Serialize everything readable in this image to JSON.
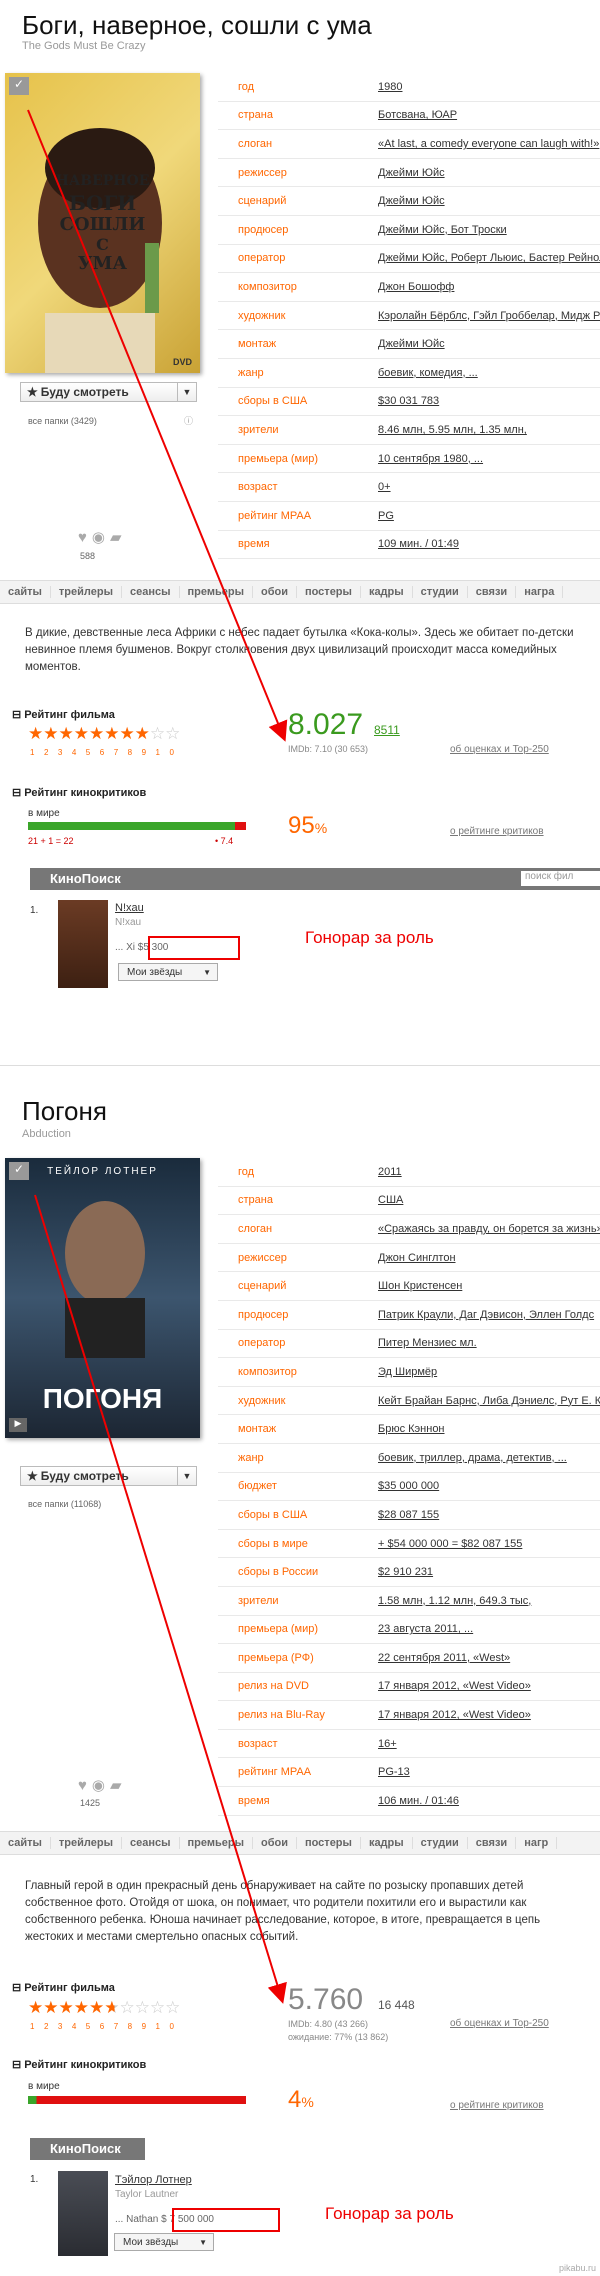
{
  "film1": {
    "title": "Боги, наверное, сошли с ума",
    "original_title": "The Gods Must Be Crazy",
    "poster_text": [
      "НАВЕРНОЕ",
      "БОГИ",
      "СОШЛИ",
      "С",
      "УМА"
    ],
    "poster_sub": "DVD",
    "info": [
      {
        "k": "год",
        "v": "1980"
      },
      {
        "k": "страна",
        "v": "Ботсвана, ЮАР"
      },
      {
        "k": "слоган",
        "v": "«At last, a comedy everyone can laugh with!»"
      },
      {
        "k": "режиссер",
        "v": "Джейми Юйс"
      },
      {
        "k": "сценарий",
        "v": "Джейми Юйс"
      },
      {
        "k": "продюсер",
        "v": "Джейми Юйс, Бот Троски"
      },
      {
        "k": "оператор",
        "v": "Джейми Юйс, Роберт Льюис, Бастер Рейнолд"
      },
      {
        "k": "композитор",
        "v": "Джон Бошофф"
      },
      {
        "k": "художник",
        "v": "Кэролайн Бёрблс, Гэйл Гроббелар, Мидж Ре"
      },
      {
        "k": "монтаж",
        "v": "Джейми Юйс"
      },
      {
        "k": "жанр",
        "v": "боевик, комедия, ..."
      },
      {
        "k": "сборы в США",
        "v": "$30 031 783"
      },
      {
        "k": "зрители",
        "v": "8.46 млн,   5.95 млн,   1.35 млн,"
      },
      {
        "k": "премьера (мир)",
        "v": "10 сентября 1980, ..."
      },
      {
        "k": "возраст",
        "v": "0+"
      },
      {
        "k": "рейтинг MPAA",
        "v": "PG"
      },
      {
        "k": "время",
        "v": "109 мин. / 01:49"
      }
    ],
    "watch_label": "Буду смотреть",
    "folders": "все папки (3429)",
    "like_count": "588",
    "tabs": [
      "сайты",
      "трейлеры",
      "сеансы",
      "премьеры",
      "обои",
      "постеры",
      "кадры",
      "студии",
      "связи",
      "награ"
    ],
    "description": "В дикие, девственные леса Африки с небес падает бутылка «Кока-колы». Здесь же обитает по-детски невинное племя бушменов. Вокруг столкновения двух цивилизаций происходит масса комедийных моментов.",
    "rating_label": "Рейтинг фильма",
    "rating": "8.027",
    "rating_votes": "8511",
    "imdb": "IMDb: 7.10 (30 653)",
    "rating_link": "об оценках и Top-250",
    "star_nums": "12345678910",
    "critics_label": "Рейтинг кинокритиков",
    "world_label": "в мире",
    "critics_counts": "21 + 1 = 22",
    "critics_score": "• 7.4",
    "critics_pct": "95",
    "critics_link": "о рейтинге критиков",
    "actor_num": "1.",
    "actor_name": "N!xau",
    "actor_orig": "N!xau",
    "actor_role": "... Xi $5 300",
    "fee_label": "Гонорар за роль",
    "my_stars": "Мои звёзды"
  },
  "film2": {
    "title": "Погоня",
    "original_title": "Abduction",
    "poster_top": "ТЕЙЛОР ЛОТНЕР",
    "poster_title": "ПОГОНЯ",
    "info": [
      {
        "k": "год",
        "v": "2011"
      },
      {
        "k": "страна",
        "v": "США"
      },
      {
        "k": "слоган",
        "v": "«Сражаясь за правду, он борется за жизнь»"
      },
      {
        "k": "режиссер",
        "v": "Джон Синглтон"
      },
      {
        "k": "сценарий",
        "v": "Шон Кристенсен"
      },
      {
        "k": "продюсер",
        "v": "Патрик Краули, Даг Дэвисон, Эллен Голдс"
      },
      {
        "k": "оператор",
        "v": "Питер Мензиес мл."
      },
      {
        "k": "композитор",
        "v": "Эд Ширмёр"
      },
      {
        "k": "художник",
        "v": "Кейт Брайан Барнс, Либа Дэниелс, Рут Е. Ка"
      },
      {
        "k": "монтаж",
        "v": "Брюс Кэннон"
      },
      {
        "k": "жанр",
        "v": "боевик, триллер, драма, детектив, ..."
      },
      {
        "k": "бюджет",
        "v": "$35 000 000"
      },
      {
        "k": "сборы в США",
        "v": "$28 087 155"
      },
      {
        "k": "сборы в мире",
        "v": "+ $54 000 000 = $82 087 155"
      },
      {
        "k": "сборы в России",
        "v": "$2 910 231"
      },
      {
        "k": "зрители",
        "v": "1.58 млн,   1.12 млн,   649.3 тыс,"
      },
      {
        "k": "премьера (мир)",
        "v": "23 августа 2011, ..."
      },
      {
        "k": "премьера (РФ)",
        "v": "22 сентября 2011, «West»"
      },
      {
        "k": "релиз на DVD",
        "v": "17 января 2012, «West Video»"
      },
      {
        "k": "релиз на Blu-Ray",
        "v": "17 января 2012, «West Video»"
      },
      {
        "k": "возраст",
        "v": "16+"
      },
      {
        "k": "рейтинг MPAA",
        "v": "PG-13"
      },
      {
        "k": "время",
        "v": "106 мин. / 01:46"
      }
    ],
    "watch_label": "Буду смотреть",
    "folders": "все папки (11068)",
    "like_count": "1425",
    "tabs": [
      "сайты",
      "трейлеры",
      "сеансы",
      "премьеры",
      "обои",
      "постеры",
      "кадры",
      "студии",
      "связи",
      "нагр"
    ],
    "description": "Главный герой в один прекрасный день обнаруживает на сайте по розыску пропавших детей собственное фото. Отойдя от шока, он понимает, что родители похитили его и вырастили как собственного ребенка. Юноша начинает расследование, которое, в итоге, превращается в цепь жестоких и местами смертельно опасных событий.",
    "rating_label": "Рейтинг фильма",
    "rating": "5.760",
    "rating_votes": "16 448",
    "imdb": "IMDb: 4.80 (43 266)",
    "expect": "ожидание: 77% (13 862)",
    "rating_link": "об оценках и Top-250",
    "star_nums": "12345678910",
    "critics_label": "Рейтинг кинокритиков",
    "world_label": "в мире",
    "critics_pct": "4",
    "critics_link": "о рейтинге критиков",
    "actor_num": "1.",
    "actor_name": "Тэйлор Лотнер",
    "actor_orig": "Taylor Lautner",
    "actor_role": "... Nathan $ 7 500 000",
    "fee_label": "Гонорар за роль",
    "my_stars": "Мои звёзды"
  },
  "kp_logo": "КиноПоиск",
  "search_placeholder": "поиск фил",
  "watermark": "pikabu.ru"
}
